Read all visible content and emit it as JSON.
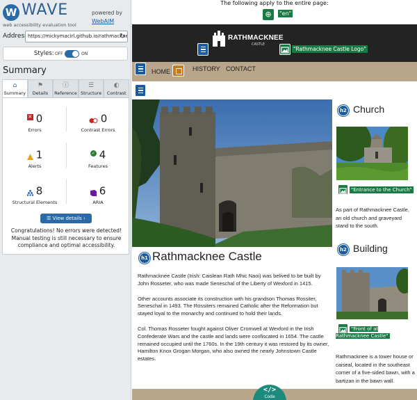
{
  "wave": {
    "logo": "WAVE",
    "subtitle": "web accessibility evaluation tool",
    "powered_by": "powered by",
    "webaim": "WebAIM",
    "address_label": "Address:",
    "address_value": "https://mickymacirl.github.io/rathmacknee",
    "styles_label": "Styles:",
    "styles_off": "OFF",
    "styles_on": "ON",
    "summary_title": "Summary",
    "tabs": [
      {
        "label": "Summary",
        "icon": "home-icon"
      },
      {
        "label": "Details",
        "icon": "flag-icon"
      },
      {
        "label": "Reference",
        "icon": "info-icon"
      },
      {
        "label": "Structure",
        "icon": "structure-icon"
      },
      {
        "label": "Contrast",
        "icon": "contrast-icon"
      }
    ],
    "stats": {
      "errors": {
        "count": "0",
        "label": "Errors",
        "color": "#c62828"
      },
      "contrast_errors": {
        "count": "0",
        "label": "Contrast Errors",
        "color": "#c62828"
      },
      "alerts": {
        "count": "1",
        "label": "Alerts",
        "color": "#e8a317"
      },
      "features": {
        "count": "4",
        "label": "Features",
        "color": "#2e7d32"
      },
      "structural": {
        "count": "8",
        "label": "Structural Elements",
        "color": "#1a5aa0"
      },
      "aria": {
        "count": "6",
        "label": "ARIA",
        "color": "#6a1b9a"
      }
    },
    "view_details": "View details ›",
    "congrats": "Congratulations! No errors were detected! Manual testing is still necessary to ensure compliance and optimal accessibility."
  },
  "page": {
    "doc_notice": "The following apply to the entire page:",
    "lang_label": "\"en\"",
    "logo_name": "RATHMACKNEE",
    "logo_sub": "CASTLE",
    "logo_alt": "\"Rathmacknee Castle Logo\"",
    "nav": [
      "HOME",
      "HISTORY",
      "CONTACT"
    ],
    "h1_badge": "h1",
    "h1": "Rathmacknee Castle",
    "paragraphs": [
      "Rathmacknee Castle (Irish: Caislean Rath Mhic Naoi) was belived to be built by John Rosseter, who was made Seneschal of the Liberty of Wexford in 1415.",
      "Other accounts associate its construction with his grandson Thomas Rossiter, Seneschal in 1493. The Rossiters remained Catholic after the Reformation but stayed loyal to the monarchy and continued to hold their lands.",
      "Col. Thomas Rosseter fought against Oliver Cromwell at Wexford in the Irish Confederate Wars and the castle and lands were confiscated in 1654. The castle remained occupied until the 1760s. In the 19th century it was restored by its owner, Hamilton Knox Grogan Morgan, who also owned the nearly Johnstown Castle estates."
    ],
    "h2_badge": "h2",
    "church_title": "Church",
    "church_alt": "\"Entrance to the Church\"",
    "church_desc": "As part of Rathmacknee Castle, an old church and graveyard stand to the south.",
    "building_title": "Building",
    "building_alt": "\"Front of at Rathmacknee Castle\"",
    "building_desc": "Rathmacknee is a tower house or caiseal, located in the southeast corner of a five-sided bawn, with a bartizan in the bawn wall.",
    "code_label": "Code"
  }
}
